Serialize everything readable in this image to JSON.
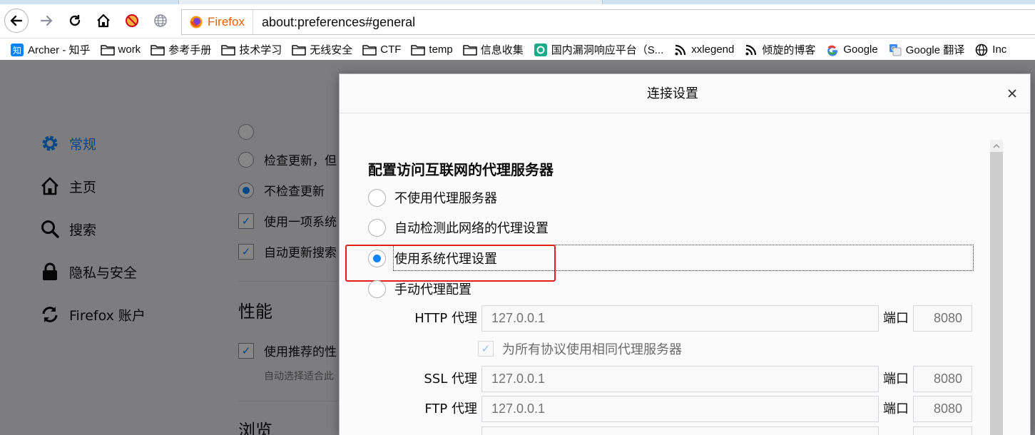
{
  "browser": {
    "identity_label": "Firefox",
    "url": "about:preferences#general",
    "bookmarks": [
      {
        "label": "Archer - 知乎",
        "icon": "zhihu-icon"
      },
      {
        "label": "work",
        "icon": "folder-icon"
      },
      {
        "label": "参考手册",
        "icon": "folder-icon"
      },
      {
        "label": "技术学习",
        "icon": "folder-icon"
      },
      {
        "label": "无线安全",
        "icon": "folder-icon"
      },
      {
        "label": "CTF",
        "icon": "folder-icon"
      },
      {
        "label": "temp",
        "icon": "folder-icon"
      },
      {
        "label": "信息收集",
        "icon": "folder-icon"
      },
      {
        "label": "国内漏洞响应平台（S...",
        "icon": "site-icon"
      },
      {
        "label": "xxlegend",
        "icon": "rss-icon"
      },
      {
        "label": "倾旋的博客",
        "icon": "rss-icon"
      },
      {
        "label": "Google",
        "icon": "google-icon"
      },
      {
        "label": "Google 翻译",
        "icon": "google-translate-icon"
      },
      {
        "label": "Inc",
        "icon": "globe-icon"
      }
    ]
  },
  "prefs": {
    "categories": [
      {
        "label": "常规",
        "icon": "gear-icon",
        "selected": true
      },
      {
        "label": "主页",
        "icon": "home-icon"
      },
      {
        "label": "搜索",
        "icon": "search-icon"
      },
      {
        "label": "隐私与安全",
        "icon": "lock-icon"
      },
      {
        "label": "Firefox 账户",
        "icon": "sync-icon"
      }
    ],
    "update_options": [
      {
        "label": "检查更新，但",
        "checked": false
      },
      {
        "label": "不检查更新",
        "checked": true
      }
    ],
    "checks": [
      {
        "label": "使用一项系统",
        "checked": true
      },
      {
        "label": "自动更新搜索",
        "checked": true
      }
    ],
    "performance_heading": "性能",
    "perf_check": {
      "label": "使用推荐的性",
      "checked": true
    },
    "perf_hint": "自动选择适合此",
    "browsing_heading": "浏览"
  },
  "dialog": {
    "title": "连接设置",
    "section_title": "配置访问互联网的代理服务器",
    "proxy_modes": [
      {
        "label": "不使用代理服务器",
        "checked": false
      },
      {
        "label": "自动检测此网络的代理设置",
        "checked": false
      },
      {
        "label": "使用系统代理设置",
        "checked": true
      },
      {
        "label": "手动代理配置",
        "checked": false
      }
    ],
    "port_label": "端口",
    "same_proxy_label": "为所有协议使用相同代理服务器",
    "same_proxy_checked": true,
    "proxies": [
      {
        "label": "HTTP 代理",
        "host": "127.0.0.1",
        "port": "8080"
      },
      {
        "label": "SSL 代理",
        "host": "127.0.0.1",
        "port": "8080"
      },
      {
        "label": "FTP 代理",
        "host": "127.0.0.1",
        "port": "8080"
      }
    ]
  }
}
